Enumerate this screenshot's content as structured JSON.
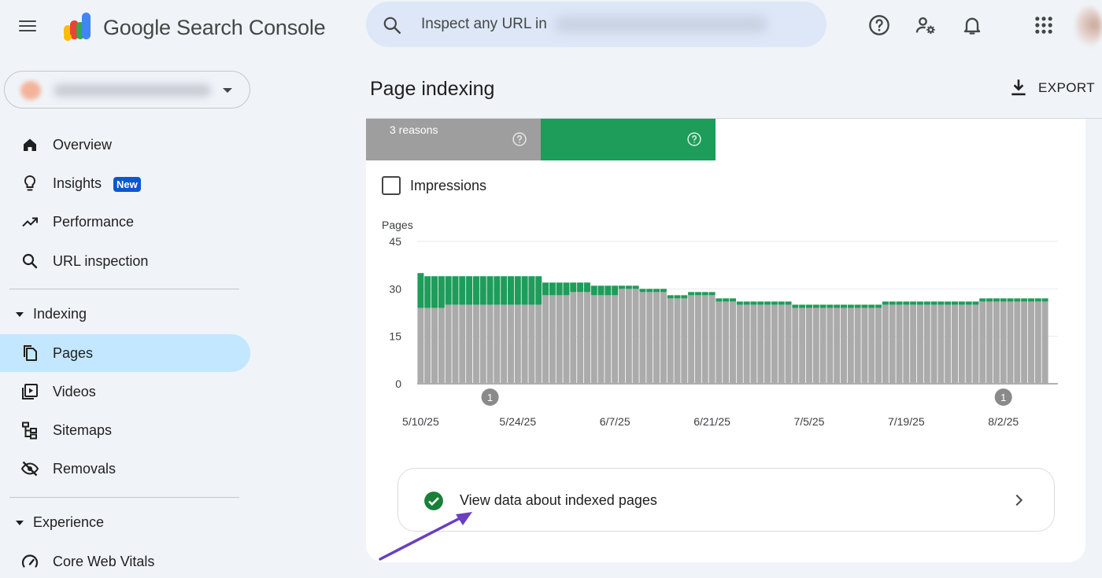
{
  "app": {
    "brand": "Google Search Console",
    "search_placeholder": "Inspect any URL in"
  },
  "colors": {
    "accent": "#0b57d0",
    "active_nav": "#c2e7ff",
    "indexed_green": "#1e9c5a",
    "not_indexed_gray": "#9e9e9e",
    "annotation_arrow": "#6a3fc0"
  },
  "top_icons": [
    "help-icon",
    "admin-settings-icon",
    "notifications-icon",
    "apps-grid-icon"
  ],
  "sidebar": {
    "items": [
      {
        "label": "Overview",
        "icon": "home-icon"
      },
      {
        "label": "Insights",
        "icon": "lightbulb-icon",
        "badge": "New"
      },
      {
        "label": "Performance",
        "icon": "trending-up-icon"
      },
      {
        "label": "URL inspection",
        "icon": "search-icon"
      }
    ],
    "sections": [
      {
        "label": "Indexing",
        "items": [
          {
            "label": "Pages",
            "icon": "pages-icon",
            "active": true
          },
          {
            "label": "Videos",
            "icon": "video-library-icon"
          },
          {
            "label": "Sitemaps",
            "icon": "sitemap-icon"
          },
          {
            "label": "Removals",
            "icon": "visibility-off-icon"
          }
        ]
      },
      {
        "label": "Experience",
        "items": [
          {
            "label": "Core Web Vitals",
            "icon": "speed-icon"
          }
        ]
      }
    ]
  },
  "main": {
    "title": "Page indexing",
    "export_label": "EXPORT",
    "summary": {
      "not_indexed_label": "3 reasons"
    },
    "impressions_label": "Impressions",
    "impressions_checked": false,
    "view_indexed_link": "View data about indexed pages"
  },
  "chart_data": {
    "type": "bar",
    "stacked": true,
    "ylabel": "Pages",
    "ylim": [
      0,
      45
    ],
    "yticks": [
      0,
      15,
      30,
      45
    ],
    "grid": true,
    "xtick_labels": [
      "5/10/25",
      "5/24/25",
      "6/7/25",
      "6/21/25",
      "7/5/25",
      "7/19/25",
      "8/2/25"
    ],
    "annotations": [
      {
        "label": "1",
        "at_date": "5/20/25"
      },
      {
        "label": "1",
        "at_date": "8/2/25"
      }
    ],
    "dates": [
      "5/10/25",
      "5/11/25",
      "5/12/25",
      "5/13/25",
      "5/14/25",
      "5/15/25",
      "5/16/25",
      "5/17/25",
      "5/18/25",
      "5/19/25",
      "5/20/25",
      "5/21/25",
      "5/22/25",
      "5/23/25",
      "5/24/25",
      "5/25/25",
      "5/26/25",
      "5/27/25",
      "5/28/25",
      "5/29/25",
      "5/30/25",
      "5/31/25",
      "6/1/25",
      "6/2/25",
      "6/3/25",
      "6/4/25",
      "6/5/25",
      "6/6/25",
      "6/7/25",
      "6/8/25",
      "6/9/25",
      "6/10/25",
      "6/11/25",
      "6/12/25",
      "6/13/25",
      "6/14/25",
      "6/15/25",
      "6/16/25",
      "6/17/25",
      "6/18/25",
      "6/19/25",
      "6/20/25",
      "6/21/25",
      "6/22/25",
      "6/23/25",
      "6/24/25",
      "6/25/25",
      "6/26/25",
      "6/27/25",
      "6/28/25",
      "6/29/25",
      "6/30/25",
      "7/1/25",
      "7/2/25",
      "7/3/25",
      "7/4/25",
      "7/5/25",
      "7/6/25",
      "7/7/25",
      "7/8/25",
      "7/9/25",
      "7/10/25",
      "7/11/25",
      "7/12/25",
      "7/13/25",
      "7/14/25",
      "7/15/25",
      "7/16/25",
      "7/17/25",
      "7/18/25",
      "7/19/25",
      "7/20/25",
      "7/21/25",
      "7/22/25",
      "7/23/25",
      "7/24/25",
      "7/25/25",
      "7/26/25",
      "7/27/25",
      "7/28/25",
      "7/29/25",
      "7/30/25",
      "7/31/25",
      "8/1/25",
      "8/2/25",
      "8/3/25",
      "8/4/25",
      "8/5/25",
      "8/6/25",
      "8/7/25",
      "8/8/25"
    ],
    "series": [
      {
        "color": "#ababab",
        "values": [
          24,
          24,
          24,
          24,
          25,
          25,
          25,
          25,
          25,
          25,
          25,
          25,
          25,
          25,
          25,
          25,
          25,
          25,
          28,
          28,
          28,
          28,
          29,
          29,
          29,
          28,
          28,
          28,
          28,
          30,
          30,
          30,
          29,
          29,
          29,
          29,
          27,
          27,
          27,
          28,
          28,
          28,
          28,
          26,
          26,
          26,
          25,
          25,
          25,
          25,
          25,
          25,
          25,
          25,
          24,
          24,
          24,
          24,
          24,
          24,
          24,
          24,
          24,
          24,
          24,
          24,
          24,
          25,
          25,
          25,
          25,
          25,
          25,
          25,
          25,
          25,
          25,
          25,
          25,
          25,
          25,
          26,
          26,
          26,
          26,
          26,
          26,
          26,
          26,
          26,
          26
        ]
      },
      {
        "color": "#1e9c5a",
        "values": [
          11,
          10,
          10,
          10,
          9,
          9,
          9,
          9,
          9,
          9,
          9,
          9,
          9,
          9,
          9,
          9,
          9,
          9,
          4,
          4,
          4,
          4,
          3,
          3,
          3,
          3,
          3,
          3,
          3,
          1,
          1,
          1,
          1,
          1,
          1,
          1,
          1,
          1,
          1,
          1,
          1,
          1,
          1,
          1,
          1,
          1,
          1,
          1,
          1,
          1,
          1,
          1,
          1,
          1,
          1,
          1,
          1,
          1,
          1,
          1,
          1,
          1,
          1,
          1,
          1,
          1,
          1,
          1,
          1,
          1,
          1,
          1,
          1,
          1,
          1,
          1,
          1,
          1,
          1,
          1,
          1,
          1,
          1,
          1,
          1,
          1,
          1,
          1,
          1,
          1,
          1
        ]
      }
    ]
  }
}
